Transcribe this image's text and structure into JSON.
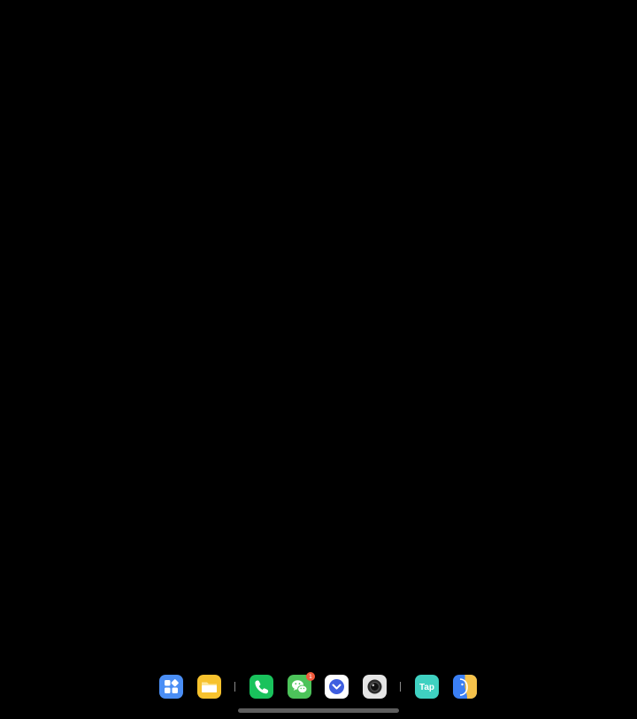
{
  "screen": {
    "background": "#000000"
  },
  "dock": {
    "apps": [
      {
        "id": "app-drawer",
        "icon": "grid-icon",
        "color": "#4a8ef5"
      },
      {
        "id": "file-manager",
        "icon": "folder-icon",
        "color": "#f7c22d"
      },
      {
        "id": "phone",
        "icon": "phone-icon",
        "color": "#19c25c"
      },
      {
        "id": "wechat",
        "icon": "chat-bubbles-icon",
        "color": "#4cc35a",
        "badge": "1"
      },
      {
        "id": "browser",
        "icon": "compass-icon",
        "color": "#ffffff"
      },
      {
        "id": "camera",
        "icon": "camera-lens-icon",
        "color": "#e5e5e5"
      },
      {
        "id": "taptap",
        "icon": "tap-logo-icon",
        "color": "#3fd1c1",
        "label": "Tap"
      },
      {
        "id": "assistant",
        "icon": "assistant-icon",
        "color": "#3a7ff5"
      }
    ],
    "badge_color": "#f25a3c"
  },
  "home_indicator": {
    "color": "#5e5e5e"
  }
}
